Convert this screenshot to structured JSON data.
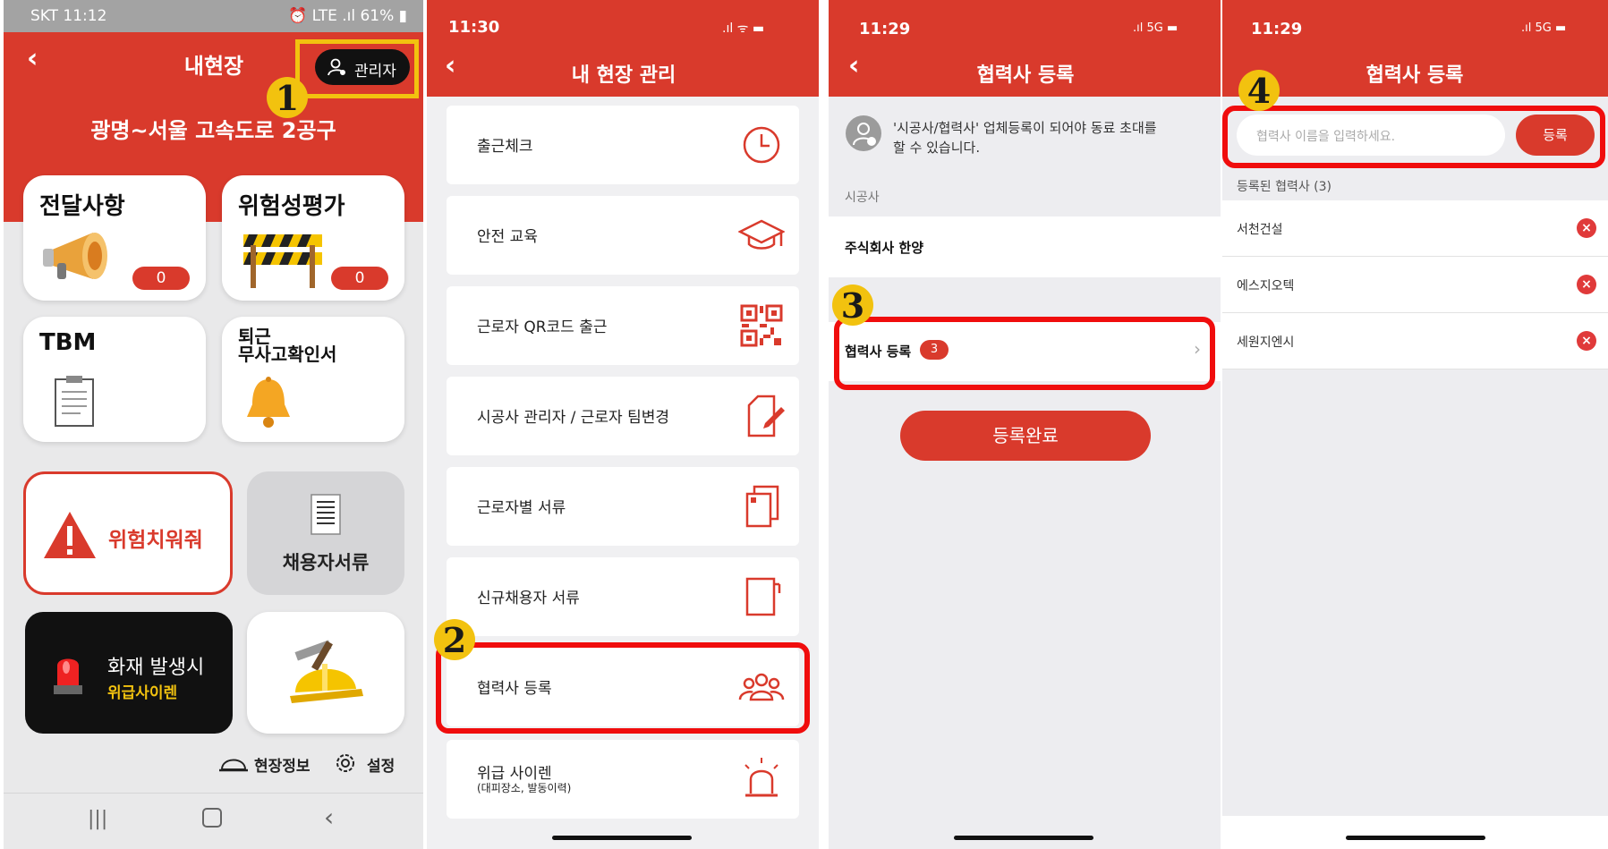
{
  "panel1": {
    "status": {
      "carrier": "SKT 11:12",
      "right": "⏰ LTE .ıl 61% ▮"
    },
    "header": {
      "title": "내현장",
      "admin_label": "관리자"
    },
    "site_name": "광명~서울 고속도로 2공구",
    "cards": {
      "notice": {
        "title": "전달사항",
        "count": "0"
      },
      "risk": {
        "title": "위험성평가",
        "count": "0"
      },
      "tbm": {
        "title": "TBM"
      },
      "leave": {
        "title_line1": "퇴근",
        "title_line2": "무사고확인서"
      }
    },
    "danger_report": "위험치워줘",
    "hire_docs": "채용자서류",
    "fire": {
      "line1": "화재 발생시",
      "line2": "위급사이렌"
    },
    "bottom": {
      "site_info": "현장정보",
      "settings": "설정"
    },
    "step": "1"
  },
  "panel2": {
    "status_time": "11:30",
    "header": {
      "title": "내 현장 관리"
    },
    "menu": [
      {
        "label": "출근체크",
        "icon": "clock-icon"
      },
      {
        "label": "안전 교육",
        "icon": "graduation-cap-icon"
      },
      {
        "label": "근로자 QR코드 출근",
        "icon": "qr-code-icon"
      },
      {
        "label": "시공사 관리자 / 근로자 팀변경",
        "icon": "edit-document-icon"
      },
      {
        "label": "근로자별 서류",
        "icon": "documents-icon"
      },
      {
        "label": "신규채용자 서류",
        "icon": "new-document-icon"
      },
      {
        "label": "협력사 등록",
        "icon": "people-group-icon"
      },
      {
        "label": "위급 사이렌",
        "sub": "(대피장소, 발동이력)",
        "icon": "siren-icon"
      }
    ],
    "step": "2"
  },
  "panel3": {
    "status_time": "11:29",
    "network": "5G",
    "header": {
      "title": "협력사 등록"
    },
    "info_text_line1": "'시공사/협력사' 업체등록이 되어야 동료 초대를",
    "info_text_line2": "할 수 있습니다.",
    "section_label": "시공사",
    "company": "주식회사 한양",
    "partner_row": {
      "label": "협력사 등록",
      "count": "3"
    },
    "done_button": "등록완료",
    "step": "3"
  },
  "panel4": {
    "status_time": "11:29",
    "network": "5G",
    "header": {
      "title": "협력사 등록"
    },
    "input_placeholder": "협력사 이름을 입력하세요.",
    "register_button": "등록",
    "list_label": "등록된 협력사 (3)",
    "partners": [
      "서천건설",
      "에스지오텍",
      "세원지엔시"
    ],
    "step": "4"
  },
  "colors": {
    "brand_red": "#d93a2c",
    "highlight_red": "#f00d0d",
    "step_yellow": "#f2c20f"
  }
}
